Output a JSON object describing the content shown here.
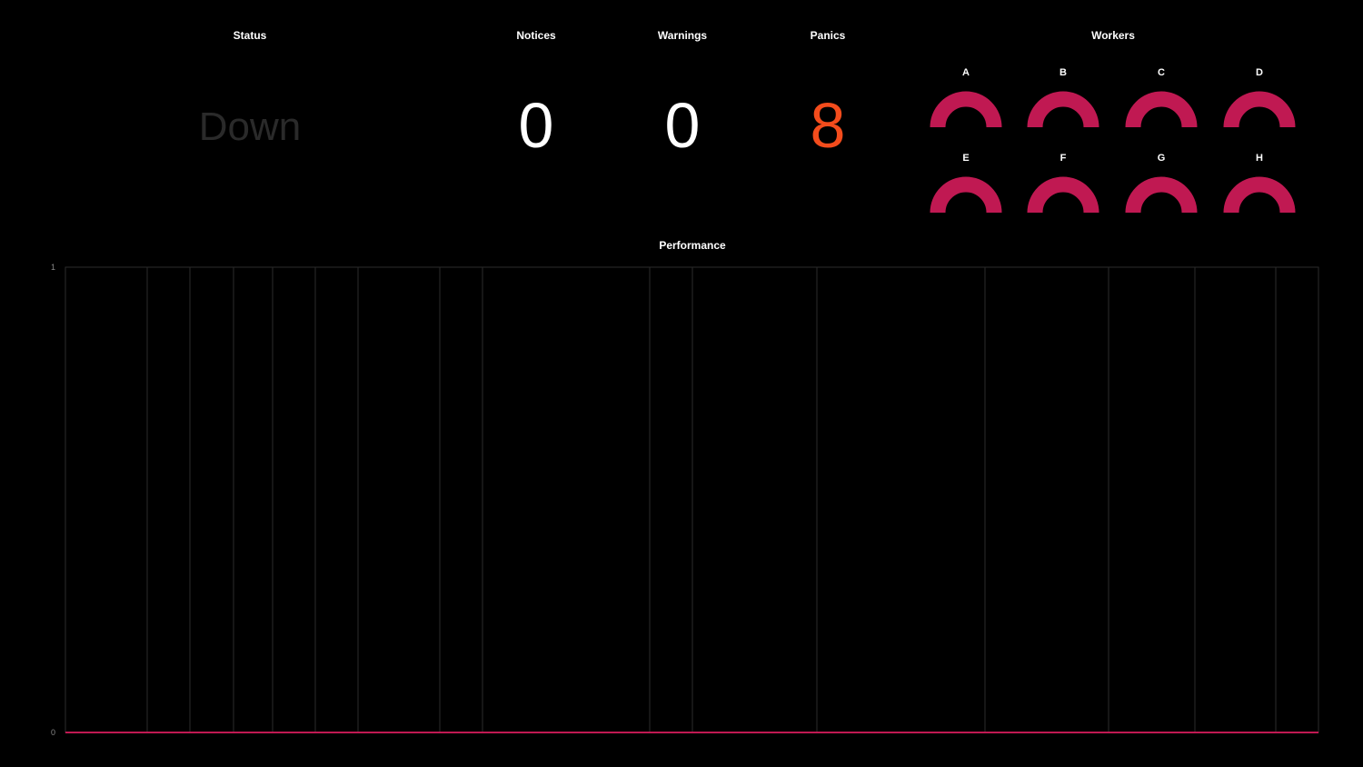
{
  "status": {
    "title": "Status",
    "value": "Down",
    "color": "#2a2a2a"
  },
  "notices": {
    "title": "Notices",
    "value": "0",
    "color": "#ffffff"
  },
  "warnings": {
    "title": "Warnings",
    "value": "0",
    "color": "#ffffff"
  },
  "panics": {
    "title": "Panics",
    "value": "8",
    "color": "#f34c1c"
  },
  "workers": {
    "title": "Workers",
    "gauge_color": "#c01952",
    "items": [
      {
        "label": "A",
        "value": 1
      },
      {
        "label": "B",
        "value": 1
      },
      {
        "label": "C",
        "value": 1
      },
      {
        "label": "D",
        "value": 1
      },
      {
        "label": "E",
        "value": 1
      },
      {
        "label": "F",
        "value": 1
      },
      {
        "label": "G",
        "value": 1
      },
      {
        "label": "H",
        "value": 1
      }
    ]
  },
  "performance": {
    "title": "Performance"
  },
  "chart_data": {
    "type": "line",
    "title": "Performance",
    "xlabel": "",
    "ylabel": "",
    "ylim": [
      0,
      1
    ],
    "y_ticks": [
      "0",
      "1"
    ],
    "grid": true,
    "line_color": "#c01952",
    "series": [
      {
        "values": [
          0,
          0,
          0,
          0,
          0,
          0,
          0,
          0,
          0,
          0,
          0,
          0,
          0,
          0,
          0,
          0,
          0
        ]
      }
    ]
  }
}
